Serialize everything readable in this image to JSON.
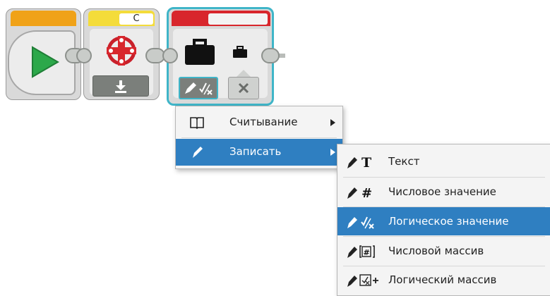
{
  "blocks": {
    "motor_port": "C",
    "colors": {
      "start_tab": "#f0a218",
      "motor_tab": "#f4dc3a",
      "variable_tab": "#d8262c",
      "play_arrow": "#2ca84a",
      "selection": "#2f7fc1",
      "block_face": "#ececec",
      "highlight_outline": "#3fb5c8"
    },
    "icons": [
      "play-icon",
      "motor-icon",
      "download-icon",
      "briefcase-icon",
      "pencil-boolean-icon",
      "close-icon"
    ]
  },
  "context_menu": {
    "items": [
      {
        "icon": "book-icon",
        "label": "Считывание",
        "has_submenu": true,
        "selected": false
      },
      {
        "icon": "pencil-icon",
        "label": "Записать",
        "has_submenu": true,
        "selected": true
      }
    ]
  },
  "submenu": {
    "items": [
      {
        "icon": "pencil-text-icon",
        "glyph": "T",
        "label": "Текст",
        "selected": false
      },
      {
        "icon": "pencil-number-icon",
        "glyph": "#",
        "label": "Числовое значение",
        "selected": false
      },
      {
        "icon": "pencil-logic-icon",
        "glyph": "✓⁄x",
        "label": "Логическое значение",
        "selected": true
      },
      {
        "icon": "pencil-numeric-array-icon",
        "glyph": "[#]",
        "label": "Числовой массив",
        "selected": false
      },
      {
        "icon": "pencil-logic-array-icon",
        "glyph": "☒+",
        "label": "Логический массив",
        "selected": false
      }
    ]
  }
}
